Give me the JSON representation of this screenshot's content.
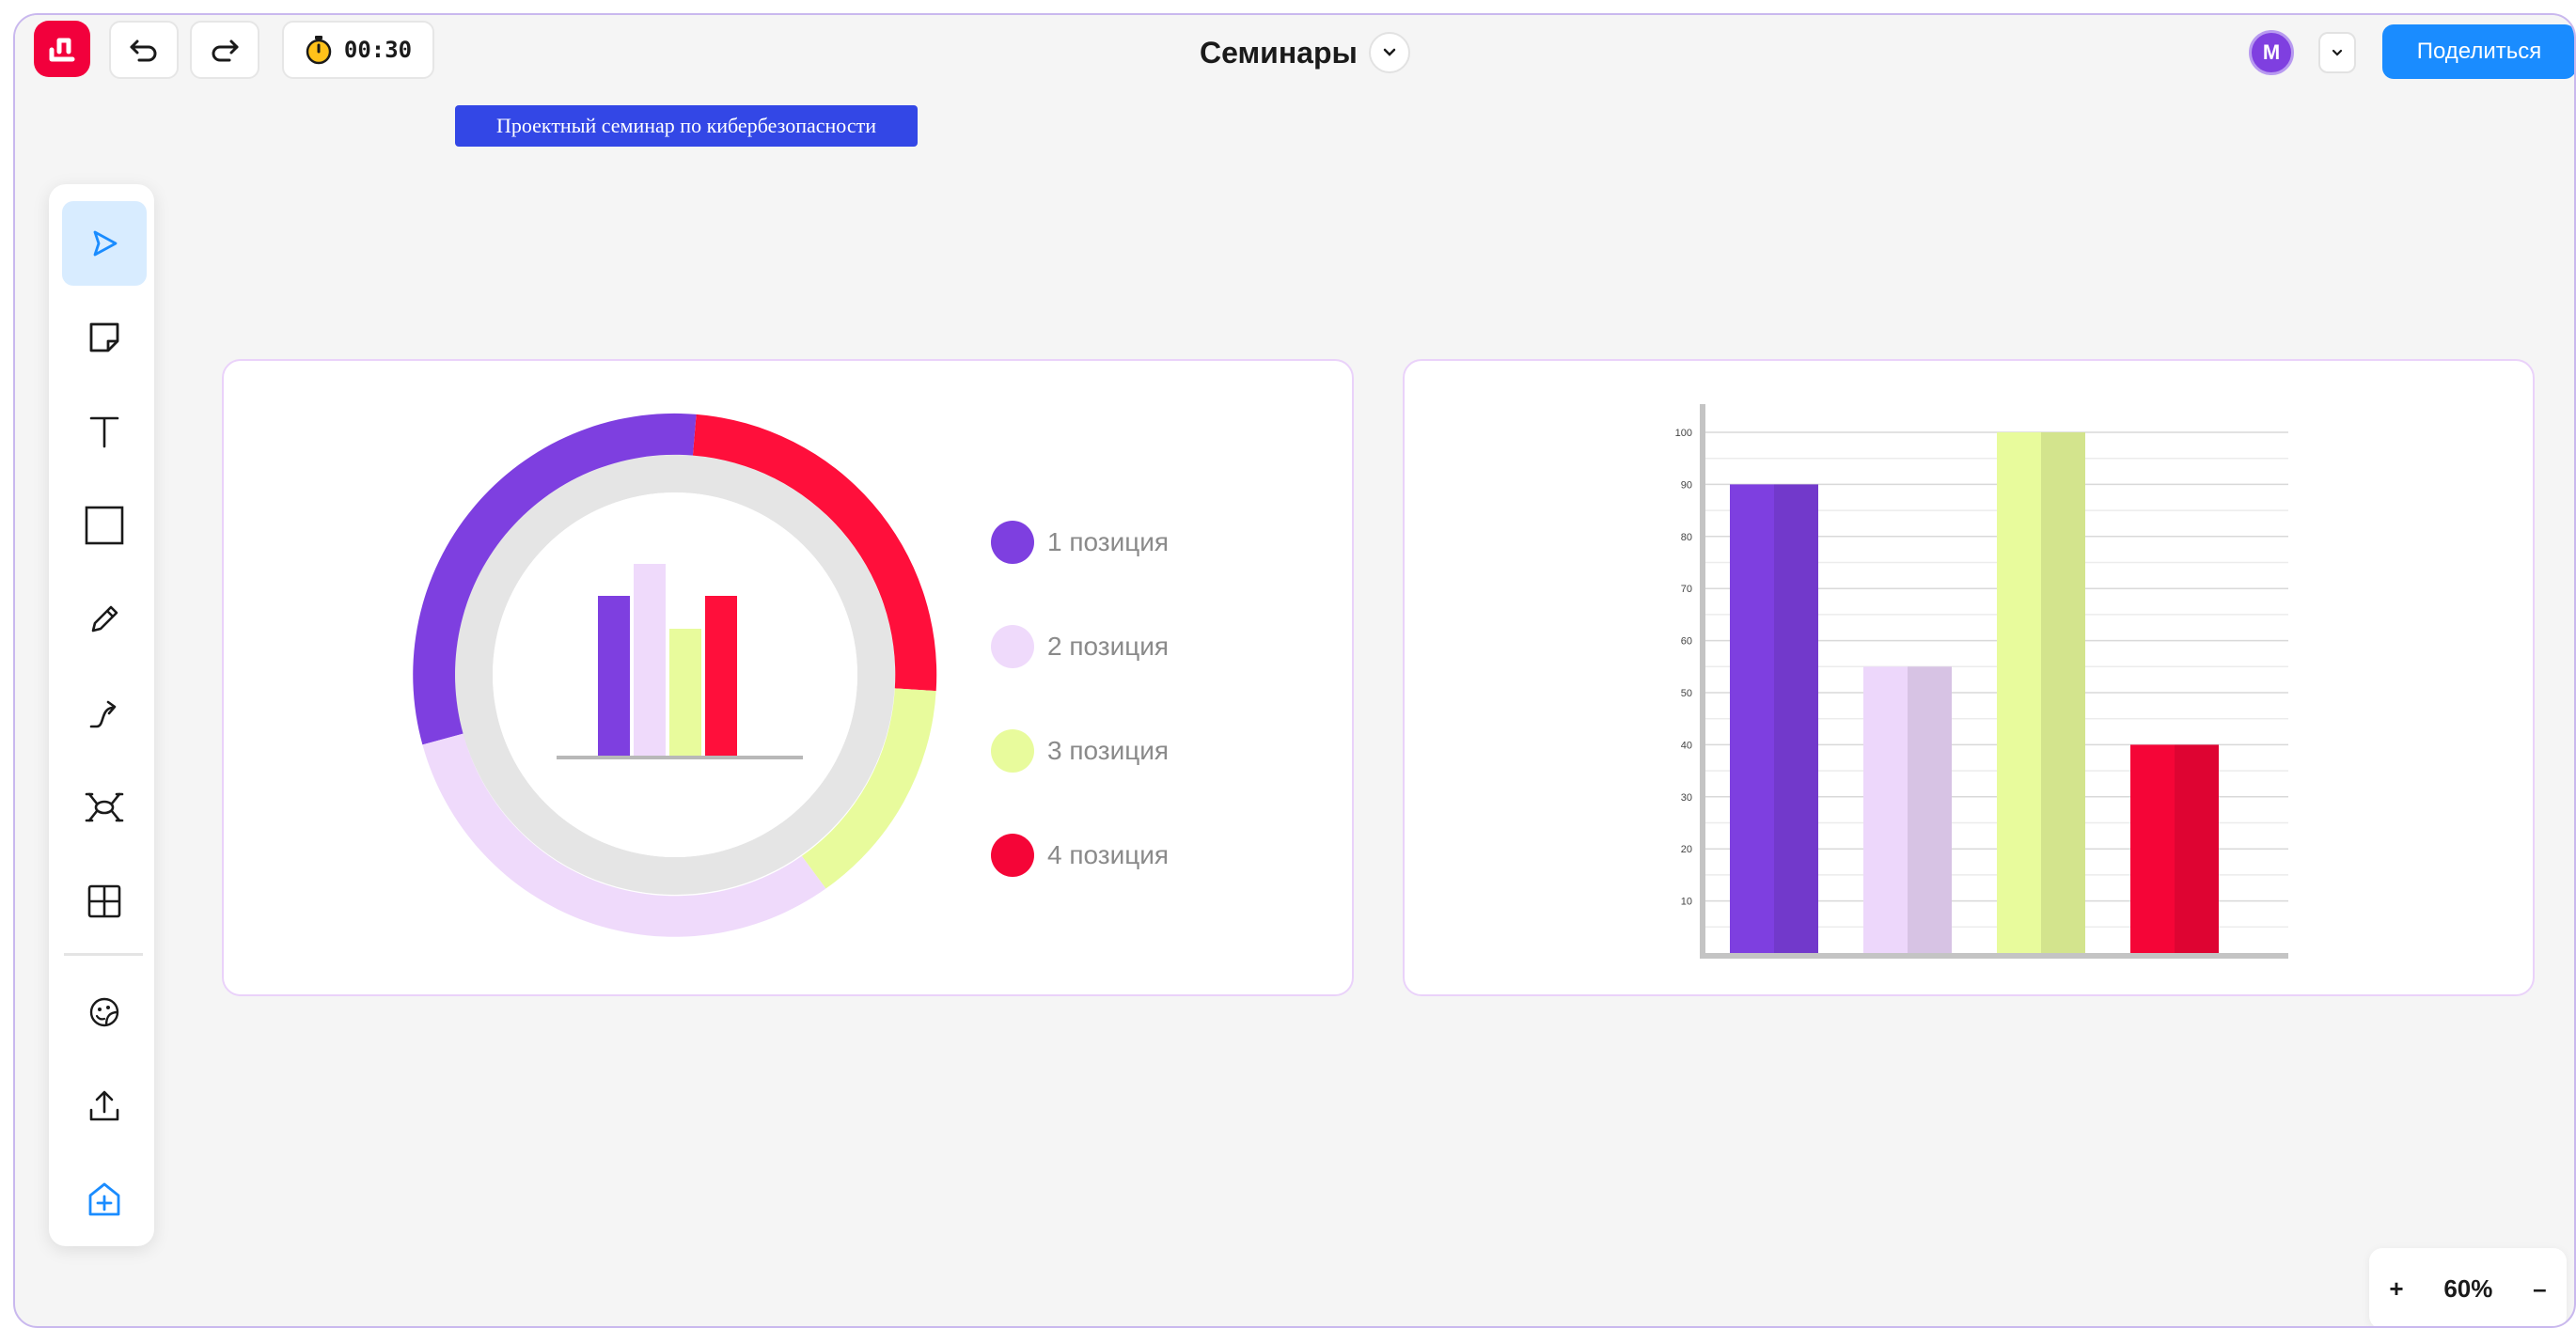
{
  "header": {
    "timer": "00:30",
    "board_title": "Семинары",
    "avatar_initial": "M",
    "share_label": "Поделиться"
  },
  "canvas": {
    "sticky_label": "Проектный семинар по кибербезопасности"
  },
  "toolbar": {
    "tools": [
      "select",
      "sticky-note",
      "text",
      "shape",
      "pen",
      "connector",
      "mind-map",
      "table",
      "stickers",
      "upload",
      "templates"
    ]
  },
  "donut": {
    "legend": [
      {
        "label": "1 позиция",
        "color": "#7e3fe0"
      },
      {
        "label": "2 позиция",
        "color": "#edd7fb"
      },
      {
        "label": "3 позиция",
        "color": "#e8fb9c"
      },
      {
        "label": "4 позиция",
        "color": "#f50537"
      }
    ]
  },
  "chart_data": {
    "type": "bar",
    "categories": [
      "1 позиция",
      "2 позиция",
      "3 позиция",
      "4 позиция"
    ],
    "values": [
      90,
      55,
      100,
      40
    ],
    "colors": [
      "#7e3fe0",
      "#edd7fb",
      "#e8fb9c",
      "#f50537"
    ],
    "ylim": [
      0,
      100
    ],
    "yticks": [
      10,
      20,
      30,
      40,
      50,
      60,
      70,
      80,
      90,
      100
    ],
    "grid": true
  },
  "zoom": {
    "plus": "+",
    "level": "60%",
    "minus": "–"
  }
}
